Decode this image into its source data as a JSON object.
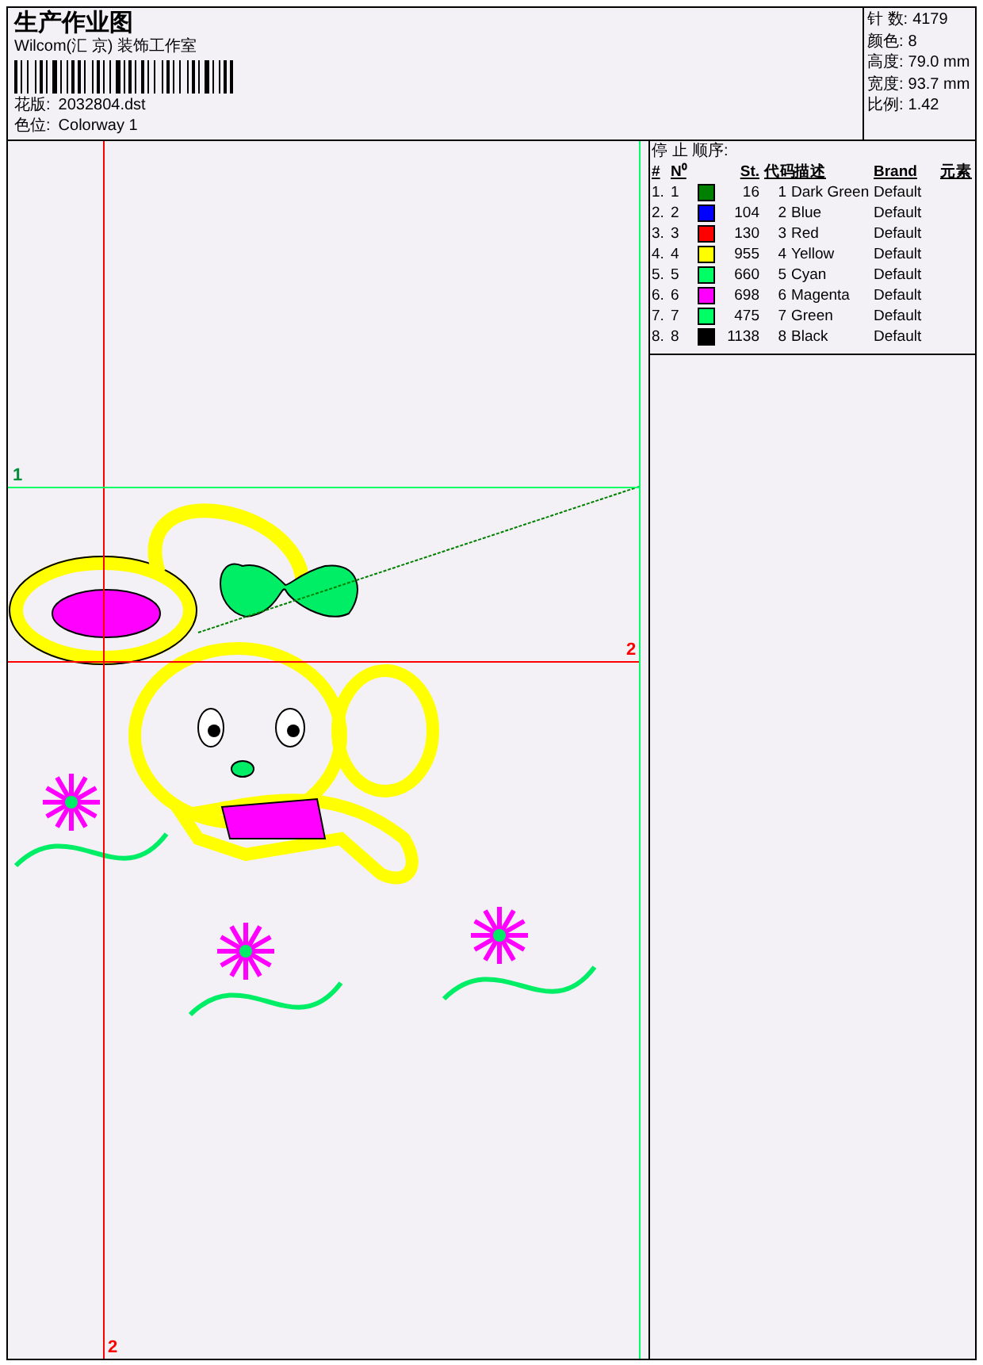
{
  "header": {
    "title": "生产作业图",
    "company": "Wilcom(汇 京) 装饰工作室",
    "fields": [
      {
        "label": "花版:",
        "value": "2032804.dst"
      },
      {
        "label": "色位:",
        "value": "Colorway 1"
      }
    ]
  },
  "stats": [
    {
      "label": "针 数:",
      "value": "4179"
    },
    {
      "label": "颜色:",
      "value": "8"
    },
    {
      "label": "高度:",
      "value": "79.0 mm"
    },
    {
      "label": "宽度:",
      "value": "93.7 mm"
    },
    {
      "label": "比例:",
      "value": "1.42"
    }
  ],
  "stop_sequence": {
    "title": "停 止 顺序:",
    "columns": [
      "#",
      "N⁰",
      "St.",
      "代码",
      "描述",
      "Brand",
      "元素"
    ],
    "rows": [
      {
        "index": "1.",
        "needle": "1",
        "color": "#008000",
        "stitches": "16",
        "code": "1",
        "description": "Dark Green",
        "brand": "Default"
      },
      {
        "index": "2.",
        "needle": "2",
        "color": "#0000ff",
        "stitches": "104",
        "code": "2",
        "description": "Blue",
        "brand": "Default"
      },
      {
        "index": "3.",
        "needle": "3",
        "color": "#ff0000",
        "stitches": "130",
        "code": "3",
        "description": "Red",
        "brand": "Default"
      },
      {
        "index": "4.",
        "needle": "4",
        "color": "#ffff00",
        "stitches": "955",
        "code": "4",
        "description": "Yellow",
        "brand": "Default"
      },
      {
        "index": "5.",
        "needle": "5",
        "color": "#00ff66",
        "stitches": "660",
        "code": "5",
        "description": "Cyan",
        "brand": "Default"
      },
      {
        "index": "6.",
        "needle": "6",
        "color": "#ff00ff",
        "stitches": "698",
        "code": "6",
        "description": "Magenta",
        "brand": "Default"
      },
      {
        "index": "7.",
        "needle": "7",
        "color": "#00ff66",
        "stitches": "475",
        "code": "7",
        "description": "Green",
        "brand": "Default"
      },
      {
        "index": "8.",
        "needle": "8",
        "color": "#000000",
        "stitches": "1138",
        "code": "8",
        "description": "Black",
        "brand": "Default"
      }
    ]
  },
  "canvas": {
    "guides": [
      {
        "kind": "vertical",
        "color": "#ff0000",
        "label": "2"
      },
      {
        "kind": "horizontal",
        "color": "#ff0000",
        "label": "2"
      },
      {
        "kind": "horizontal",
        "color": "#00ff66",
        "label": "1"
      }
    ]
  }
}
